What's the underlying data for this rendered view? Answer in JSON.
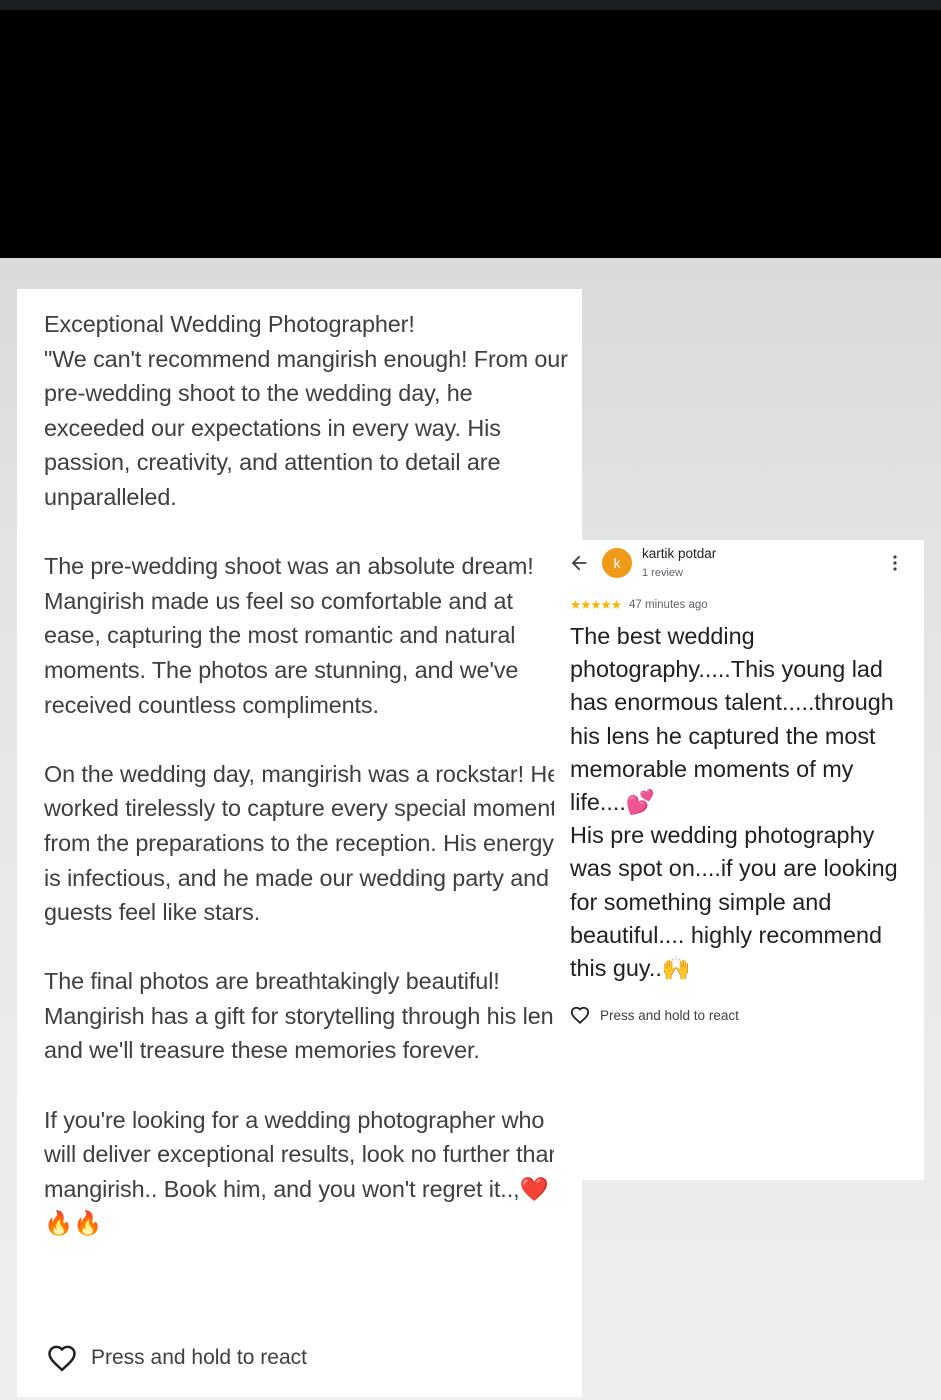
{
  "left_review": {
    "text": "Exceptional Wedding Photographer!\n\"We can't recommend mangirish enough! From our pre-wedding shoot to the wedding day, he exceeded our expectations in every way. His passion, creativity, and attention to detail are unparalleled.\n\nThe pre-wedding shoot was an absolute dream! Mangirish made us feel so comfortable and at ease, capturing the most romantic and natural moments. The photos are stunning, and we've received countless compliments.\n\nOn the wedding day, mangirish was a rockstar! He worked tirelessly to capture every special moment, from the preparations to the reception. His energy is infectious, and he made our wedding party and guests feel like stars.\n\nThe final photos are breathtakingly beautiful! Mangirish has a gift for storytelling through his lens, and we'll treasure these memories forever.\n\nIf you're looking for a wedding photographer who will deliver exceptional results, look no further than mangirish.. Book him, and you won't regret it..,❤️🔥🔥",
    "react_label": "Press and hold to react"
  },
  "right_review": {
    "avatar_letter": "k",
    "reviewer_name": "kartik potdar",
    "reviewer_reviews": "1 review",
    "stars": "★★★★★",
    "rating": 5,
    "time": "47 minutes ago",
    "text": "The best wedding photography.....This young lad has enormous talent.....through his lens he captured the most memorable moments of my life....💕\nHis pre wedding photography was spot on....if you are looking for something simple and beautiful.... highly recommend this guy..🙌",
    "react_label": "Press and hold to react"
  },
  "colors": {
    "avatar": "#f09a1a",
    "stars": "#f4b400",
    "text": "#3c4043"
  },
  "icons": {
    "back": "arrow-left-icon",
    "more": "more-vert-icon",
    "react": "heart-outline-icon"
  }
}
